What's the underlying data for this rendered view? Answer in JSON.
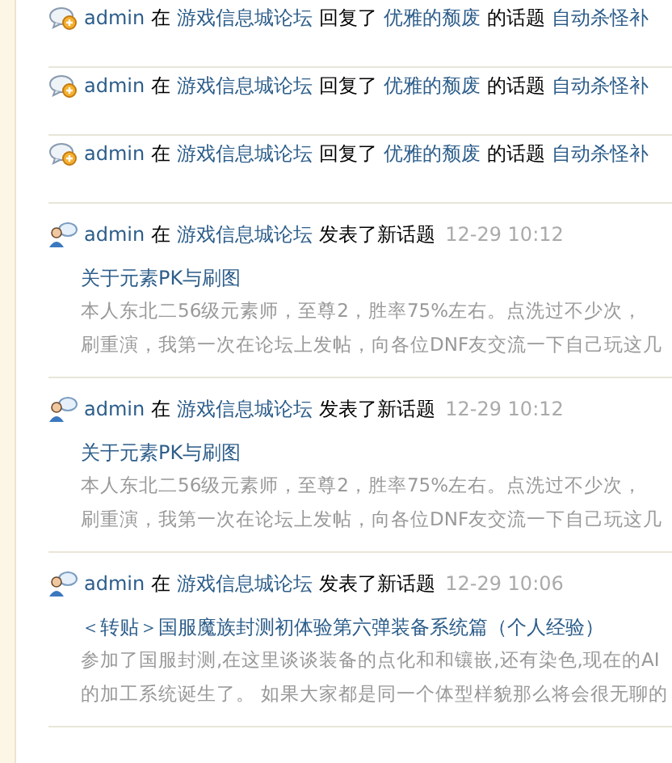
{
  "activities": [
    {
      "kind": "reply",
      "user": "admin",
      "prep": "在",
      "forum": "游戏信息城论坛",
      "action": "回复了",
      "target_user": "优雅的颓废",
      "suffix": "的话题",
      "topic": "自动杀怪补"
    },
    {
      "kind": "reply",
      "user": "admin",
      "prep": "在",
      "forum": "游戏信息城论坛",
      "action": "回复了",
      "target_user": "优雅的颓废",
      "suffix": "的话题",
      "topic": "自动杀怪补"
    },
    {
      "kind": "reply",
      "user": "admin",
      "prep": "在",
      "forum": "游戏信息城论坛",
      "action": "回复了",
      "target_user": "优雅的颓废",
      "suffix": "的话题",
      "topic": "自动杀怪补"
    },
    {
      "kind": "topic",
      "user": "admin",
      "prep": "在",
      "forum": "游戏信息城论坛",
      "action": "发表了新话题",
      "time": "12-29 10:12",
      "title": "关于元素PK与刷图",
      "excerpt": [
        "本人东北二56级元素师，至尊2，胜率75%左右。点洗过不少次，",
        "刷重演，我第一次在论坛上发帖，向各位DNF友交流一下自己玩这几"
      ]
    },
    {
      "kind": "topic",
      "user": "admin",
      "prep": "在",
      "forum": "游戏信息城论坛",
      "action": "发表了新话题",
      "time": "12-29 10:12",
      "title": "关于元素PK与刷图",
      "excerpt": [
        "本人东北二56级元素师，至尊2，胜率75%左右。点洗过不少次，",
        "刷重演，我第一次在论坛上发帖，向各位DNF友交流一下自己玩这几"
      ]
    },
    {
      "kind": "topic",
      "user": "admin",
      "prep": "在",
      "forum": "游戏信息城论坛",
      "action": "发表了新话题",
      "time": "12-29 10:06",
      "title": "＜转贴＞国服魔族封测初体验第六弹装备系统篇（个人经验）",
      "excerpt": [
        "参加了国服封测,在这里谈谈装备的点化和和镶嵌,还有染色,现在的AI",
        "的加工系统诞生了。 如果大家都是同一个体型样貌那么将会很无聊的"
      ]
    }
  ]
}
